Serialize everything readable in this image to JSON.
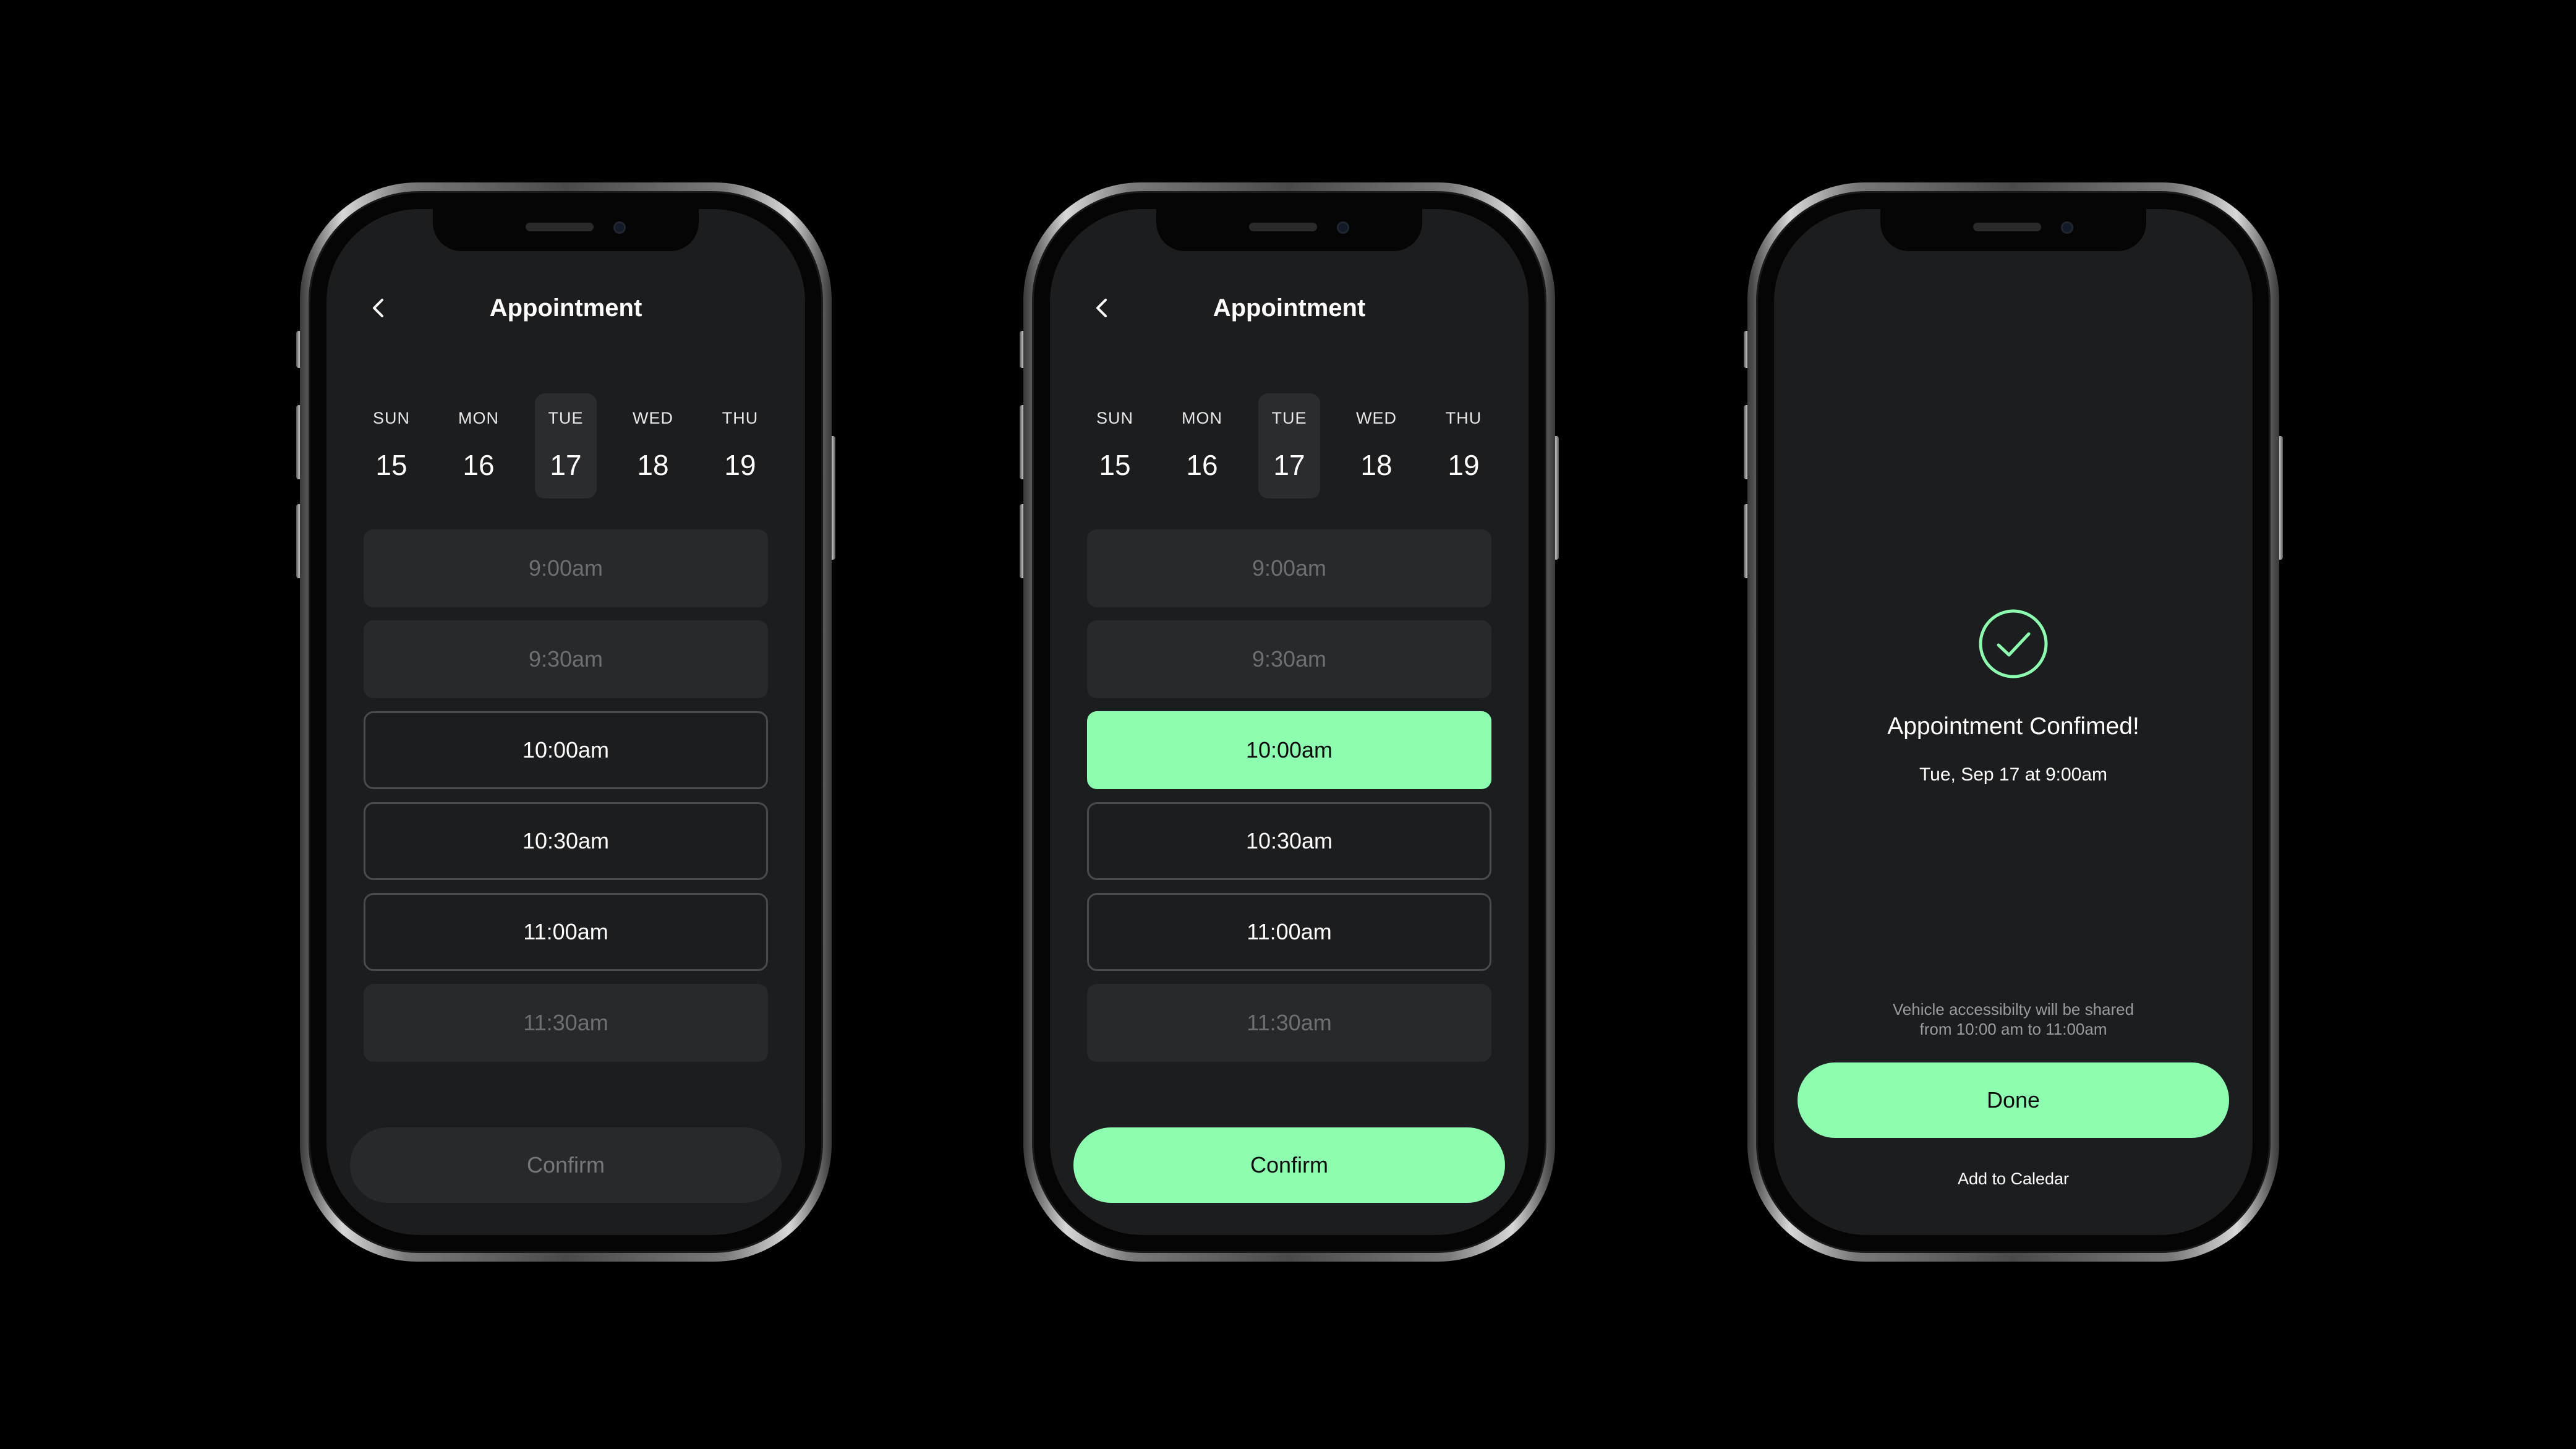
{
  "colors": {
    "background": "#000000",
    "screen": "#1c1d1f",
    "accent": "#8dfdb0",
    "disabled_slot": "#28292c",
    "disabled_text": "#6e6f72"
  },
  "screens": [
    {
      "header": {
        "back_icon": "chevron-left-icon",
        "title": "Appointment"
      },
      "days": [
        {
          "name": "SUN",
          "num": "15"
        },
        {
          "name": "MON",
          "num": "16"
        },
        {
          "name": "TUE",
          "num": "17"
        },
        {
          "name": "WED",
          "num": "18"
        },
        {
          "name": "THU",
          "num": "19"
        }
      ],
      "slots": [
        "9:00am",
        "9:30am",
        "10:00am",
        "10:30am",
        "11:00am",
        "11:30am"
      ],
      "confirm_label": "Confirm"
    },
    {
      "header": {
        "back_icon": "chevron-left-icon",
        "title": "Appointment"
      },
      "days": [
        {
          "name": "SUN",
          "num": "15"
        },
        {
          "name": "MON",
          "num": "16"
        },
        {
          "name": "TUE",
          "num": "17"
        },
        {
          "name": "WED",
          "num": "18"
        },
        {
          "name": "THU",
          "num": "19"
        }
      ],
      "slots": [
        "9:00am",
        "9:30am",
        "10:00am",
        "10:30am",
        "11:00am",
        "11:30am"
      ],
      "confirm_label": "Confirm"
    },
    {
      "check_icon": "check-circle-icon",
      "title": "Appointment Confimed!",
      "date": "Tue, Sep 17 at 9:00am",
      "note_line1": "Vehicle accessibilty will be shared",
      "note_line2": "from 10:00 am to 11:00am",
      "done_label": "Done",
      "add_calendar_label": "Add to Caledar"
    }
  ]
}
